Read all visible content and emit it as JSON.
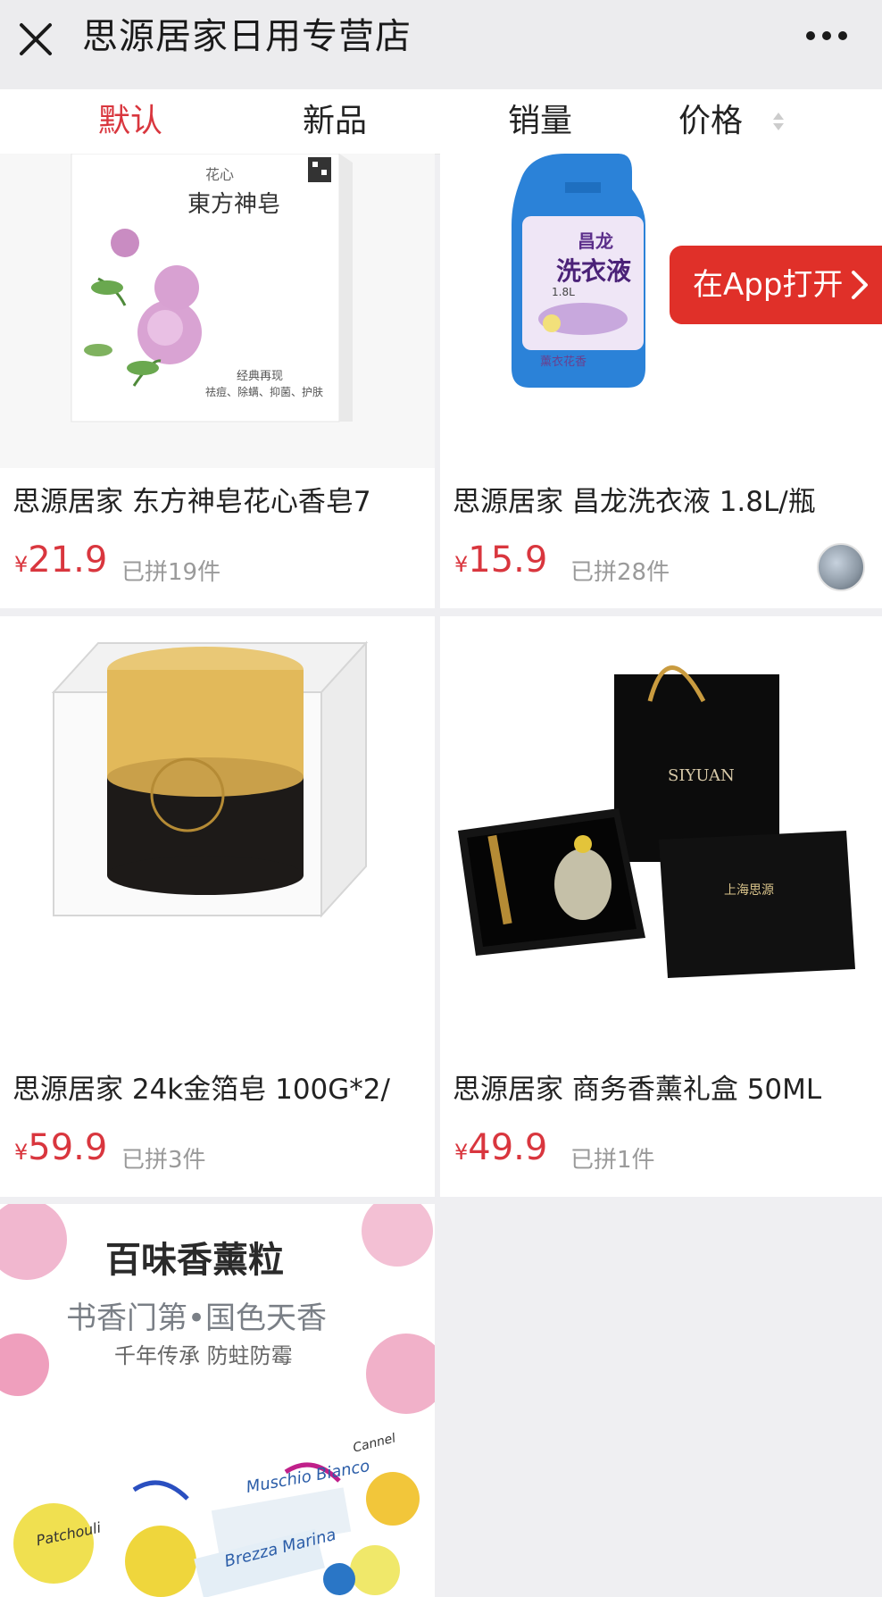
{
  "header": {
    "title": "思源居家日用专营店"
  },
  "tabs": [
    {
      "label": "默认"
    },
    {
      "label": "新品"
    },
    {
      "label": "销量"
    },
    {
      "label": "价格"
    }
  ],
  "open_app": {
    "label": "在App打开"
  },
  "products": [
    {
      "name": "思源居家 东方神皂花心香皂7",
      "currency": "¥",
      "price": "21.9",
      "sold": "已拼19件",
      "image_texts": {
        "brand": "花心",
        "title": "東方神皂",
        "line1": "经典再现",
        "line2": "祛痘、除螨、抑菌、护肤"
      }
    },
    {
      "name": "思源居家 昌龙洗衣液 1.8L/瓶",
      "currency": "¥",
      "price": "15.9",
      "sold": "已拼28件",
      "image_texts": {
        "brand": "昌龙",
        "title": "洗衣液",
        "volume": "1.8L",
        "bottom": "薰衣花香"
      }
    },
    {
      "name": "思源居家 24k金箔皂 100G*2/",
      "currency": "¥",
      "price": "59.9",
      "sold": "已拼3件",
      "image_texts": {}
    },
    {
      "name": "思源居家 商务香薰礼盒 50ML",
      "currency": "¥",
      "price": "49.9",
      "sold": "已拼1件",
      "image_texts": {
        "bag": "SIYUAN",
        "box": "上海思源"
      }
    }
  ],
  "banner": {
    "title": "百味香薰粒",
    "subtitle": "书香门第•国色天香",
    "tagline": "千年传承 防蛀防霉",
    "tags": [
      "Muschio Bianco",
      "Brezza Marina",
      "Patchouli",
      "Cannel"
    ]
  },
  "colors": {
    "accent": "#d9363e",
    "app_button": "#e03029",
    "background": "#efeff2"
  }
}
